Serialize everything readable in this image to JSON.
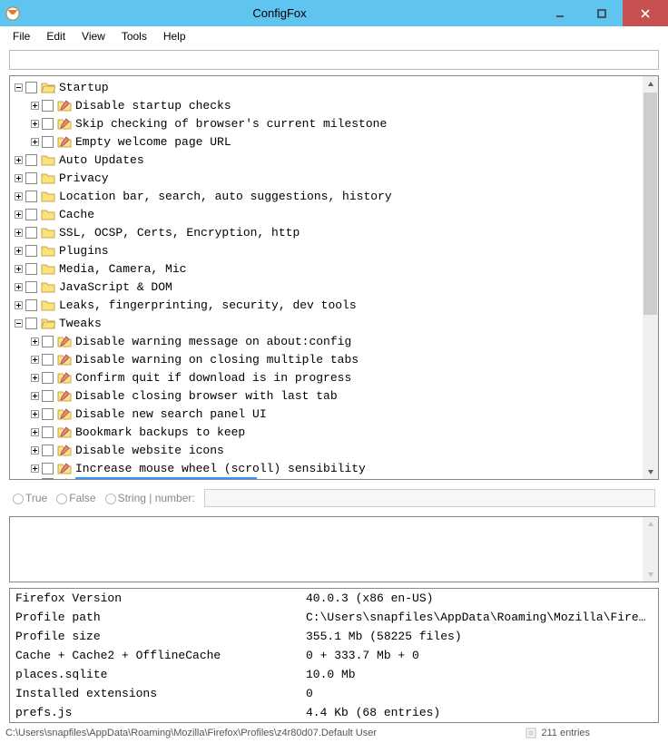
{
  "window": {
    "title": "ConfigFox"
  },
  "menu": {
    "file": "File",
    "edit": "Edit",
    "view": "View",
    "tools": "Tools",
    "help": "Help"
  },
  "tree": {
    "startup": "Startup",
    "startup_children": {
      "a": "Disable startup checks",
      "b": "Skip checking of browser's current milestone",
      "c": "Empty welcome page URL"
    },
    "auto_updates": "Auto Updates",
    "privacy": "Privacy",
    "location": "Location bar, search, auto suggestions, history",
    "cache": "Cache",
    "ssl": "SSL, OCSP, Certs, Encryption, http",
    "plugins": "Plugins",
    "media": "Media, Camera, Mic",
    "js": "JavaScript & DOM",
    "leaks": "Leaks, fingerprinting, security, dev tools",
    "tweaks": "Tweaks",
    "tweaks_children": {
      "a": "Disable warning message on about:config",
      "b": "Disable warning on closing multiple tabs",
      "c": "Confirm quit if download is in progress",
      "d": "Disable closing browser with last tab",
      "e": "Disable new search panel UI",
      "f": "Bookmark backups to keep",
      "g": "Disable website icons",
      "h": "Increase mouse wheel (scroll) sensibility"
    }
  },
  "value_bar": {
    "true": "True",
    "false": "False",
    "string": "String | number:"
  },
  "info": {
    "ffver_k": "Firefox Version",
    "ffver_v": "40.0.3 (x86 en-US)",
    "path_k": "Profile path",
    "path_v": "C:\\Users\\snapfiles\\AppData\\Roaming\\Mozilla\\Firefox\\Pr...",
    "size_k": "Profile size",
    "size_v": "355.1 Mb (58225 files)",
    "cache_k": "Cache + Cache2 + OfflineCache",
    "cache_v": "0 + 333.7 Mb + 0",
    "places_k": "places.sqlite",
    "places_v": "10.0 Mb",
    "ext_k": "Installed extensions",
    "ext_v": "0",
    "prefs_k": "prefs.js",
    "prefs_v": "4.4 Kb (68 entries)"
  },
  "status": {
    "path": "C:\\Users\\snapfiles\\AppData\\Roaming\\Mozilla\\Firefox\\Profiles\\z4r80d07.Default User",
    "entries": "211 entries"
  }
}
